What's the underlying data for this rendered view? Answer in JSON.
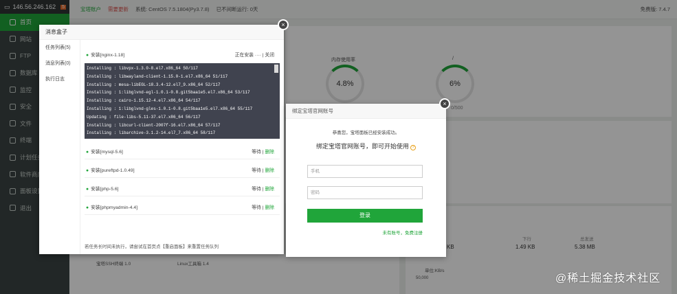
{
  "header": {
    "ip": "146.56.246.162",
    "badge": "5"
  },
  "sidebar": {
    "items": [
      {
        "label": "首页"
      },
      {
        "label": "网站"
      },
      {
        "label": "FTP"
      },
      {
        "label": "数据库"
      },
      {
        "label": "监控"
      },
      {
        "label": "安全"
      },
      {
        "label": "文件"
      },
      {
        "label": "终端"
      },
      {
        "label": "计划任务"
      },
      {
        "label": "软件商店"
      },
      {
        "label": "面板设置"
      },
      {
        "label": "退出"
      }
    ]
  },
  "topbar": {
    "account": "宝塔账户",
    "update": "需要更新",
    "system": "系统: CentOS 7.5.1804(Py3.7.8)",
    "uptime": "已不间断运行: 0天",
    "version": "免费版: 7.4.7"
  },
  "dashboard": {
    "memory_label": "内存使用率",
    "memory_value": "4.8%",
    "disk_label": "/",
    "disk_value": "6%",
    "disk_sub": "0/500",
    "upload_label": "下行",
    "upload_value": "1.49 KB",
    "total_label": "总发送",
    "total_value": "5.38 MB",
    "kb_left": "KB",
    "chart_label": "单位:KB/s",
    "chart_tick": "50,000",
    "ssh_label": "宝塔SSH终端 1.0",
    "linux_label": "Linux工具箱 1.4"
  },
  "msgbox": {
    "title": "消息盒子",
    "tabs": [
      "任务列表(5)",
      "消息列表(0)",
      "执行日志"
    ],
    "current": {
      "name": "安装[nginx-1.18]",
      "status": "正在安装 ···· | 关闭"
    },
    "console": [
      "Installing : libvpx-1.3.0-8.el7.x86_64 50/117",
      "Installing : libwayland-client-1.15.0-1.el7.x86_64 51/117",
      "Installing : mesa-libEGL-18.3.4-12.el7_9.x86_64 52/117",
      "Installing : 1:libglvnd-egl-1.0.1-0.8.git5baa1e5.el7.x86_64 53/117",
      "Installing : cairo-1.15.12-4.el7.x86_64 54/117",
      "Installing : 1:libglvnd-gles-1.0.1-0.8.git5baa1e5.el7.x86_64 55/117",
      "Updating : file-libs-5.11-37.el7.x86_64 56/117",
      "Installing : libcurl-client-2007f-16.el7.x86_64 57/117",
      "Installing : libarchive-3.1.2-14.el7_7.x86_64 58/117"
    ],
    "tasks": [
      {
        "name": "安装[mysql-5.6]",
        "wait": "等待",
        "del": "删除"
      },
      {
        "name": "安装[pureftpd-1.0.49]",
        "wait": "等待",
        "del": "删除"
      },
      {
        "name": "安装[php-5.6]",
        "wait": "等待",
        "del": "删除"
      },
      {
        "name": "安装[phpmyadmin-4.4]",
        "wait": "等待",
        "del": "删除"
      }
    ],
    "hint": "若任务长时间未执行，请尝试在首页点【重启面板】来重置任务队列"
  },
  "bind": {
    "title": "绑定宝塔官网账号",
    "msg": "恭喜您，宝塔面板已经安装成功。",
    "sub": "绑定宝塔官网账号，即可开始使用",
    "phone_placeholder": "手机",
    "password_placeholder": "密码",
    "login": "登录",
    "register": "未有账号，免费注册"
  },
  "watermark": "@稀土掘金技术社区",
  "colors": {
    "accent": "#20a53a",
    "sidebar": "#3c4444",
    "console": "#40434f"
  }
}
